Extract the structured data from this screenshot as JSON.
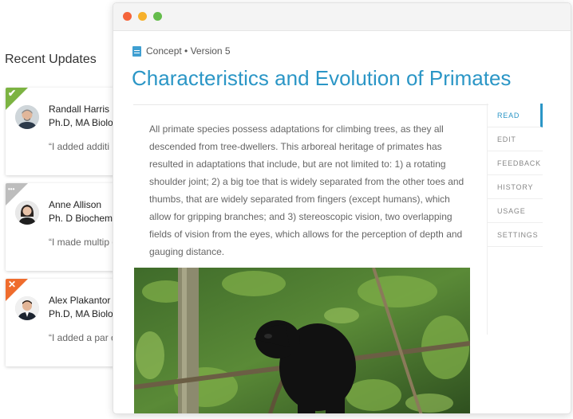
{
  "sidebar": {
    "title": "Recent Updates",
    "updates": [
      {
        "name": "Randall Harris",
        "credentials": "Ph.D, MA Biolo",
        "quote": "“I added additi information su",
        "status": "approved",
        "status_color": "#7cb342",
        "glyph": "✔"
      },
      {
        "name": "Anne Allison",
        "credentials": "Ph. D Biochem",
        "quote": "“I made multip grammar and p",
        "status": "pending",
        "status_color": "#bdbdbd",
        "glyph": "•••"
      },
      {
        "name": "Alex Plakantor",
        "credentials": "Ph.D, MA Biolo",
        "quote": "“I added a par on the origin o",
        "status": "rejected",
        "status_color": "#ef6c2d",
        "glyph": "✕"
      }
    ]
  },
  "window": {
    "controls": [
      {
        "name": "close",
        "color": "#f5643a"
      },
      {
        "name": "minimize",
        "color": "#f6b02a"
      },
      {
        "name": "maximize",
        "color": "#64bc4b"
      }
    ],
    "breadcrumb": "Concept • Version 5",
    "title": "Characteristics and Evolution of Primates",
    "body": "All primate species possess adaptations for climbing trees, as they all descended from tree-dwellers. This arboreal heritage of primates has resulted in adaptations that include, but are not limited to: 1) a rotating shoulder joint; 2) a big toe that is widely separated from the other toes and thumbs, that are widely separated from fingers (except humans), which allow for gripping branches; and 3) stereoscopic vision, two overlapping fields of vision from the eyes, which allows for the perception of depth and gauging distance.",
    "image_alt": "howler monkey in tree",
    "tabs": [
      "READ",
      "EDIT",
      "FEEDBACK",
      "HISTORY",
      "USAGE",
      "SETTINGS"
    ],
    "active_tab": "READ",
    "accent_color": "#2b96c6"
  }
}
